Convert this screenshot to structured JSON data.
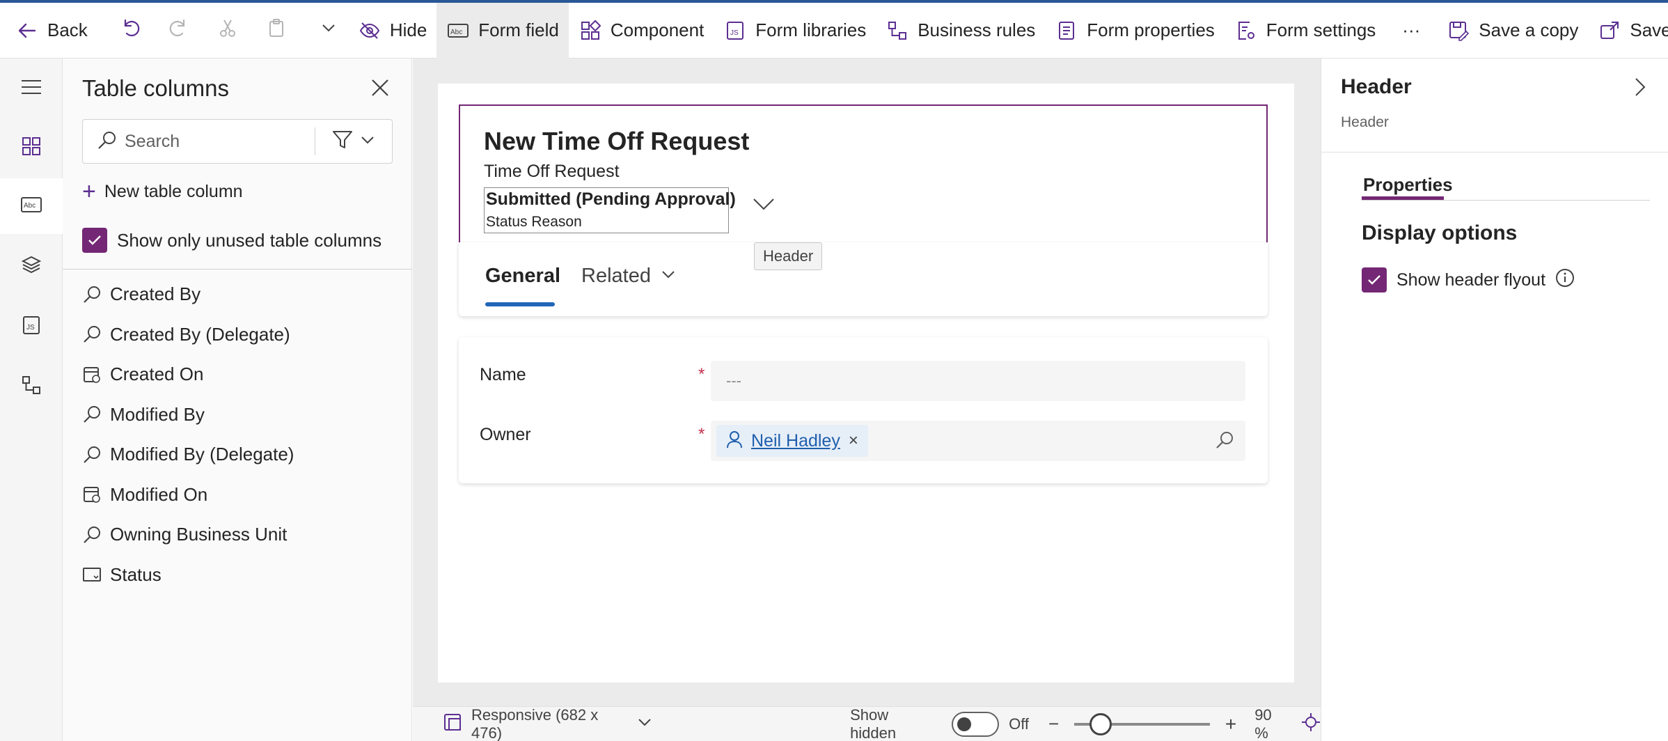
{
  "toolbar": {
    "back": "Back",
    "hide": "Hide",
    "form_field": "Form field",
    "component": "Component",
    "form_libraries": "Form libraries",
    "business_rules": "Business rules",
    "form_properties": "Form properties",
    "form_settings": "Form settings",
    "more": "···",
    "save_copy": "Save a copy",
    "save_publish": "Save and pu"
  },
  "columns_panel": {
    "title": "Table columns",
    "search_placeholder": "Search",
    "new_column": "New table column",
    "show_unused": "Show only unused table columns",
    "items": [
      {
        "label": "Created By",
        "icon": "lookup-icon"
      },
      {
        "label": "Created By (Delegate)",
        "icon": "lookup-icon"
      },
      {
        "label": "Created On",
        "icon": "calendar-icon"
      },
      {
        "label": "Modified By",
        "icon": "lookup-icon"
      },
      {
        "label": "Modified By (Delegate)",
        "icon": "lookup-icon"
      },
      {
        "label": "Modified On",
        "icon": "calendar-icon"
      },
      {
        "label": "Owning Business Unit",
        "icon": "lookup-icon"
      },
      {
        "label": "Status",
        "icon": "option-set-icon"
      }
    ]
  },
  "form": {
    "title": "New Time Off Request",
    "entity": "Time Off Request",
    "header_field_value": "Submitted (Pending Approval)",
    "header_field_label": "Status Reason",
    "tooltip": "Header",
    "tabs": [
      "General",
      "Related"
    ],
    "fields": [
      {
        "label": "Name",
        "required": "*",
        "value": "---"
      },
      {
        "label": "Owner",
        "required": "*",
        "value": "Neil Hadley",
        "remove": "×"
      }
    ]
  },
  "statusbar": {
    "layout": "Responsive (682 x 476)",
    "show_hidden": "Show hidden",
    "toggle_state": "Off",
    "zoom_minus": "−",
    "zoom_plus": "+",
    "zoom": "90 %",
    "zoom_value": 90
  },
  "properties": {
    "title": "Header",
    "subtitle": "Header",
    "tab": "Properties",
    "section": "Display options",
    "flyout_label": "Show header flyout"
  },
  "colors": {
    "accent": "#742774",
    "link": "#1f5fad",
    "required": "#c4314b"
  }
}
